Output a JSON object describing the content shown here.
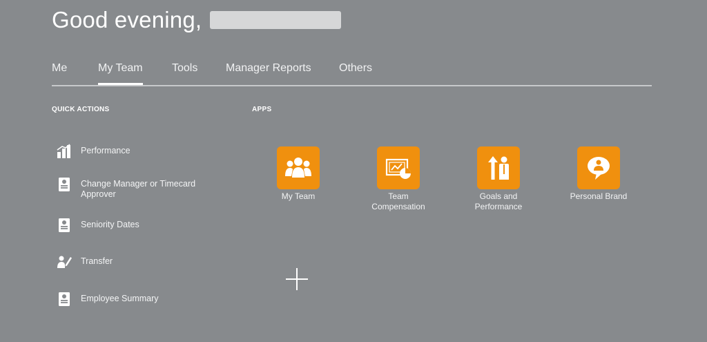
{
  "header": {
    "greeting": "Good evening,"
  },
  "tabs": [
    {
      "label": "Me"
    },
    {
      "label": "My Team"
    },
    {
      "label": "Tools"
    },
    {
      "label": "Manager Reports"
    },
    {
      "label": "Others"
    }
  ],
  "active_tab": "My Team",
  "quick_actions": {
    "title": "QUICK ACTIONS",
    "items": [
      {
        "label": "Performance",
        "icon": "bar-chart-icon"
      },
      {
        "label": "Change Manager or Timecard Approver",
        "icon": "id-card-icon"
      },
      {
        "label": "Seniority Dates",
        "icon": "id-card-icon"
      },
      {
        "label": "Transfer",
        "icon": "person-edit-icon"
      },
      {
        "label": "Employee Summary",
        "icon": "id-card-icon"
      }
    ]
  },
  "apps": {
    "title": "APPS",
    "items": [
      {
        "label": "My Team",
        "icon": "team-icon"
      },
      {
        "label": "Team Compensation",
        "icon": "money-chart-icon"
      },
      {
        "label": "Goals and Performance",
        "icon": "arrows-person-icon"
      },
      {
        "label": "Personal Brand",
        "icon": "speech-person-icon"
      }
    ]
  },
  "add_button": {
    "icon": "plus-icon"
  },
  "colors": {
    "background": "#878a8d",
    "tile": "#f0900e",
    "text": "#ffffff"
  }
}
